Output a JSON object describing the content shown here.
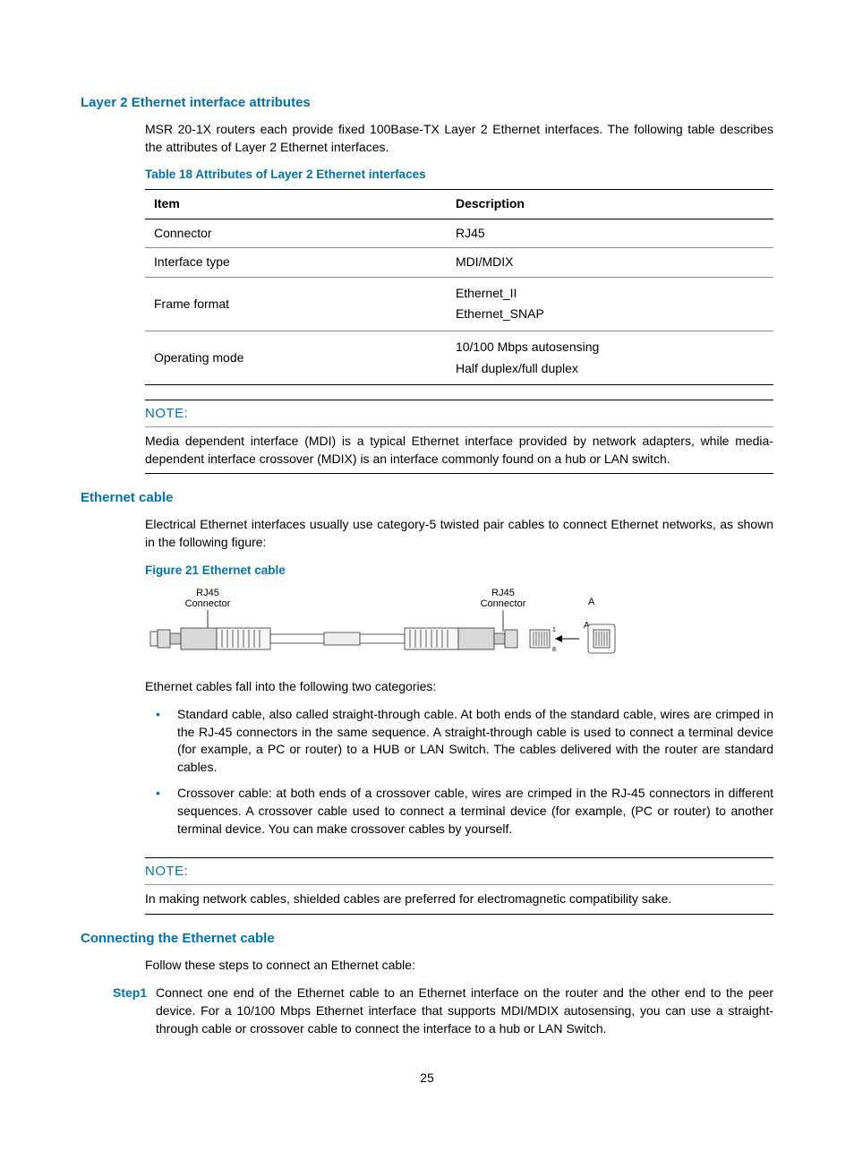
{
  "section1": {
    "heading": "Layer 2 Ethernet interface attributes",
    "intro": "MSR 20-1X routers each provide fixed 100Base-TX Layer 2 Ethernet interfaces. The following table describes the attributes of Layer 2 Ethernet interfaces.",
    "table_caption": "Table 18 Attributes of Layer 2 Ethernet interfaces",
    "headers": {
      "item": "Item",
      "desc": "Description"
    },
    "rows": [
      {
        "item": "Connector",
        "desc": "RJ45"
      },
      {
        "item": "Interface type",
        "desc": "MDI/MDIX"
      },
      {
        "item": "Frame format",
        "desc_lines": [
          "Ethernet_II",
          "Ethernet_SNAP"
        ]
      },
      {
        "item": "Operating mode",
        "desc_lines": [
          "10/100 Mbps autosensing",
          "Half duplex/full duplex"
        ]
      }
    ],
    "note_label": "NOTE:",
    "note_text": "Media dependent interface (MDI) is a typical Ethernet interface provided by network adapters, while media-dependent interface crossover (MDIX) is an interface commonly found on a hub or LAN switch."
  },
  "section2": {
    "heading": "Ethernet cable",
    "intro": "Electrical Ethernet interfaces usually use category-5 twisted pair cables to connect Ethernet networks, as shown in the following figure:",
    "figure_caption": "Figure 21 Ethernet cable",
    "figure_labels": {
      "rj45_left": "RJ45\nConnector",
      "rj45_right": "RJ45\nConnector",
      "a1": "A",
      "a2": "A"
    },
    "categories_intro": "Ethernet cables fall into the following two categories:",
    "bullets": [
      "Standard cable, also called straight-through cable. At both ends of the standard cable, wires are crimped in the RJ-45 connectors in the same sequence. A straight-through cable is used to connect a terminal device (for example, a PC or router) to a HUB or LAN Switch. The cables delivered with the router are standard cables.",
      "Crossover cable: at both ends of a crossover cable, wires are crimped in the RJ-45 connectors in different sequences. A crossover cable used to connect a terminal device (for example, (PC or router) to another terminal device. You can make crossover cables by yourself."
    ],
    "note_label": "NOTE:",
    "note_text": "In making network cables, shielded cables are preferred for electromagnetic compatibility sake."
  },
  "section3": {
    "heading": "Connecting the Ethernet cable",
    "intro": "Follow these steps to connect an Ethernet cable:",
    "step_label": "Step1",
    "step_text": "Connect one end of the Ethernet cable to an Ethernet interface on the router and the other end to the peer device. For a 10/100 Mbps Ethernet interface that supports MDI/MDIX autosensing, you can use a straight-through cable or crossover cable to connect the interface to a hub or LAN Switch."
  },
  "page_number": "25"
}
